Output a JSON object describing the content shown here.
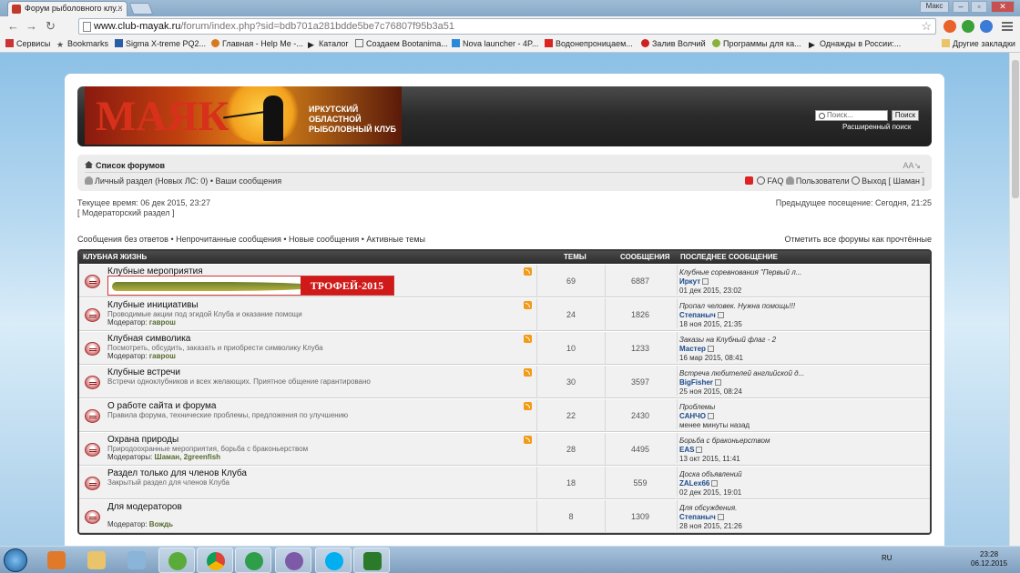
{
  "browser": {
    "tab_title": "Форум рыболовного клу...",
    "url_host": "www.club-mayak.ru",
    "url_path": "/forum/index.php?sid=bdb701a281bdde5be7c76807f95b3a51",
    "window_user": "Макс",
    "bookmarks": [
      "Сервисы",
      "Bookmarks",
      "Sigma X-treme PQ2...",
      "Главная - Help Me -...",
      "Каталог",
      "Создаем Bootanima...",
      "Nova launcher - 4P...",
      "Водонепроницаем...",
      "Залив Волчий",
      "Программы для ка...",
      "Однажды в России:...",
      "Другие закладки"
    ]
  },
  "header": {
    "brand": "МАЯК",
    "club_line1": "ИРКУТСКИЙ ОБЛАСТНОЙ",
    "club_line2": "РЫБОЛОВНЫЙ КЛУБ",
    "search_placeholder": "Поиск...",
    "search_button": "Поиск",
    "advanced_search": "Расширенный поиск"
  },
  "nav": {
    "forum_list": "Список форумов",
    "font_size": "AA↘",
    "personal": "Личный раздел (Новых ЛС: 0)",
    "your_posts": "• Ваши сообщения",
    "faq": "FAQ",
    "users": "Пользователи",
    "logout": "Выход [ Шаман ]"
  },
  "info": {
    "current_time": "Текущее время: 06 дек 2015, 23:27",
    "mod_section": "[ Модераторский раздел ]",
    "last_visit": "Предыдущее посещение: Сегодня, 21:25"
  },
  "links": {
    "left": "Сообщения без ответов • Непрочитанные сообщения • Новые сообщения • Активные темы",
    "right": "Отметить все форумы как прочтённые"
  },
  "table": {
    "category": "КЛУБНАЯ ЖИЗНЬ",
    "col_topics": "ТЕМЫ",
    "col_posts": "СООБЩЕНИЯ",
    "col_last": "ПОСЛЕДНЕЕ СООБЩЕНИЕ",
    "banner_text": "ТРОФЕЙ-2015",
    "rows": [
      {
        "title": "Клубные мероприятия",
        "desc": "",
        "mod_label": "",
        "mods": "",
        "topics": "69",
        "posts": "6887",
        "last_title": "Клубные соревнования \"Первый л...",
        "last_user": "Иркут",
        "last_date": "01 дек 2015, 23:02"
      },
      {
        "title": "Клубные инициативы",
        "desc": "Проводимые акции под эгидой Клуба и оказание помощи",
        "mod_label": "Модератор:",
        "mods": "гаврош",
        "topics": "24",
        "posts": "1826",
        "last_title": "Пропал человек. Нужна помощь!!!",
        "last_user": "Степаныч",
        "last_date": "18 ноя 2015, 21:35"
      },
      {
        "title": "Клубная символика",
        "desc": "Посмотреть, обсудить, заказать и приобрести символику Клуба",
        "mod_label": "Модератор:",
        "mods": "гаврош",
        "topics": "10",
        "posts": "1233",
        "last_title": "Заказы на Клубный флаг - 2",
        "last_user": "Мастер",
        "last_date": "16 мар 2015, 08:41"
      },
      {
        "title": "Клубные встречи",
        "desc": "Встречи одноклубников и всех желающих. Приятное общение гарантировано",
        "mod_label": "",
        "mods": "",
        "topics": "30",
        "posts": "3597",
        "last_title": "Встреча любителей английской д...",
        "last_user": "BigFisher",
        "last_date": "25 ноя 2015, 08:24"
      },
      {
        "title": "О работе сайта и форума",
        "desc": "Правила форума, технические проблемы, предложения по улучшению",
        "mod_label": "",
        "mods": "",
        "topics": "22",
        "posts": "2430",
        "last_title": "Проблемы",
        "last_user": "САНЧО",
        "last_date": "менее минуты назад"
      },
      {
        "title": "Охрана природы",
        "desc": "Природоохранные мероприятия, борьба с браконьерством",
        "mod_label": "Модераторы:",
        "mods": "Шаман, 2greenfish",
        "topics": "28",
        "posts": "4495",
        "last_title": "Борьба с браконьерством",
        "last_user": "EAS",
        "last_date": "13 окт 2015, 11:41"
      },
      {
        "title": "Раздел только для членов Клуба",
        "desc": "Закрытый раздел для членов Клуба",
        "mod_label": "",
        "mods": "",
        "topics": "18",
        "posts": "559",
        "last_title": "Доска объявлений",
        "last_user": "ZALex66",
        "last_date": "02 дек 2015, 19:01"
      },
      {
        "title": "Для модераторов",
        "desc": "",
        "mod_label": "Модератор:",
        "mods": "Вождь",
        "topics": "8",
        "posts": "1309",
        "last_title": "Для обсуждения.",
        "last_user": "Степаныч",
        "last_date": "28 ноя 2015, 21:26"
      }
    ]
  },
  "taskbar": {
    "lang": "RU",
    "time": "23:28",
    "date": "06.12.2015"
  },
  "colors": {
    "accent": "#d01a1a",
    "rss": "#f29b18",
    "header_bg": "#2a2a2a"
  }
}
